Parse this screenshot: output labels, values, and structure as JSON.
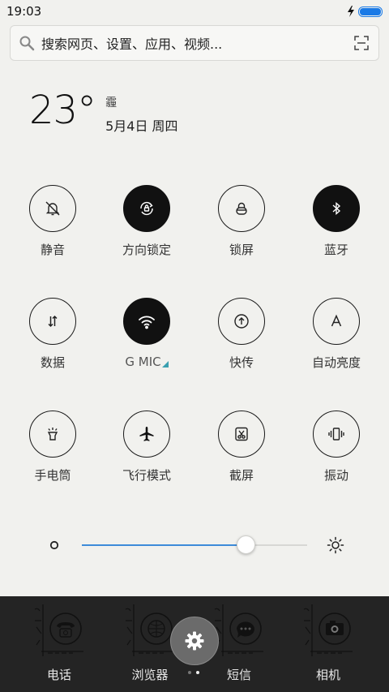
{
  "status_bar": {
    "time": "19:03",
    "charging_icon": "bolt-icon",
    "battery_level": 1.0,
    "accent": "#1a7ae6"
  },
  "search": {
    "placeholder": "搜索网页、设置、应用、视频...",
    "left_icon": "search-icon",
    "right_icon": "scan-icon"
  },
  "weather": {
    "temperature": "23°",
    "condition": "霾",
    "date": "5月4日 周四"
  },
  "toggles": [
    {
      "label": "静音",
      "icon": "bell-off-icon",
      "active": false
    },
    {
      "label": "方向锁定",
      "icon": "rotation-lock-icon",
      "active": true
    },
    {
      "label": "锁屏",
      "icon": "lock-icon",
      "active": false
    },
    {
      "label": "蓝牙",
      "icon": "bluetooth-icon",
      "active": true
    },
    {
      "label": "数据",
      "icon": "data-arrows-icon",
      "active": false
    },
    {
      "label": "G MIC",
      "icon": "wifi-icon",
      "active": true
    },
    {
      "label": "快传",
      "icon": "upload-icon",
      "active": false
    },
    {
      "label": "自动亮度",
      "icon": "auto-brightness-icon",
      "active": false
    },
    {
      "label": "手电筒",
      "icon": "flashlight-icon",
      "active": false
    },
    {
      "label": "飞行模式",
      "icon": "airplane-icon",
      "active": false
    },
    {
      "label": "截屏",
      "icon": "screenshot-icon",
      "active": false
    },
    {
      "label": "振动",
      "icon": "vibrate-icon",
      "active": false
    }
  ],
  "brightness": {
    "level": 0.73,
    "min_icon": "brightness-low-icon",
    "max_icon": "brightness-high-icon",
    "accent": "#3d8bd9"
  },
  "dock": [
    {
      "label": "电话",
      "icon": "phone-icon"
    },
    {
      "label": "浏览器",
      "icon": "browser-icon"
    },
    {
      "label": "短信",
      "icon": "message-icon"
    },
    {
      "label": "相机",
      "icon": "camera-icon"
    }
  ],
  "settings_button": {
    "icon": "gear-icon"
  },
  "page_indicator": {
    "pages": 2,
    "current": 2
  }
}
